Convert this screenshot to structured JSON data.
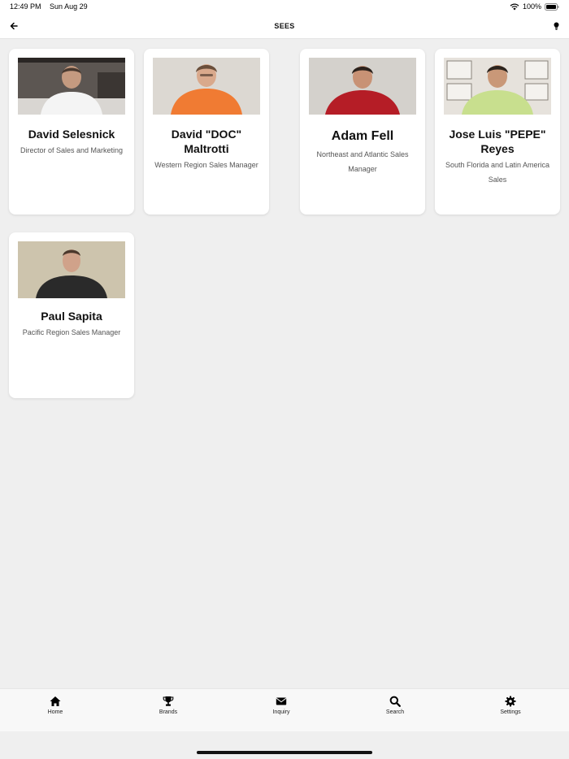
{
  "status_bar": {
    "time": "12:49 PM",
    "date": "Sun Aug 29",
    "battery": "100%"
  },
  "nav": {
    "title": "SEES",
    "back_icon": "arrow-left-icon",
    "tip_icon": "lightbulb-icon"
  },
  "contacts": [
    {
      "name": "David Selesnick",
      "title": "Director of Sales and Marketing"
    },
    {
      "name": "David \"DOC\" Maltrotti",
      "title": "Western Region Sales Manager"
    },
    {
      "name": "Adam Fell",
      "title": "Northeast and Atlantic Sales Manager"
    },
    {
      "name": "Jose Luis \"PEPE\" Reyes",
      "title": "South Florida and Latin America Sales"
    },
    {
      "name": "Paul Sapita",
      "title": "Pacific Region Sales Manager"
    }
  ],
  "tabs": [
    {
      "label": "Home",
      "icon": "home-icon"
    },
    {
      "label": "Brands",
      "icon": "trophy-icon"
    },
    {
      "label": "Inquiry",
      "icon": "envelope-icon"
    },
    {
      "label": "Search",
      "icon": "search-icon"
    },
    {
      "label": "Settings",
      "icon": "gear-icon"
    }
  ]
}
